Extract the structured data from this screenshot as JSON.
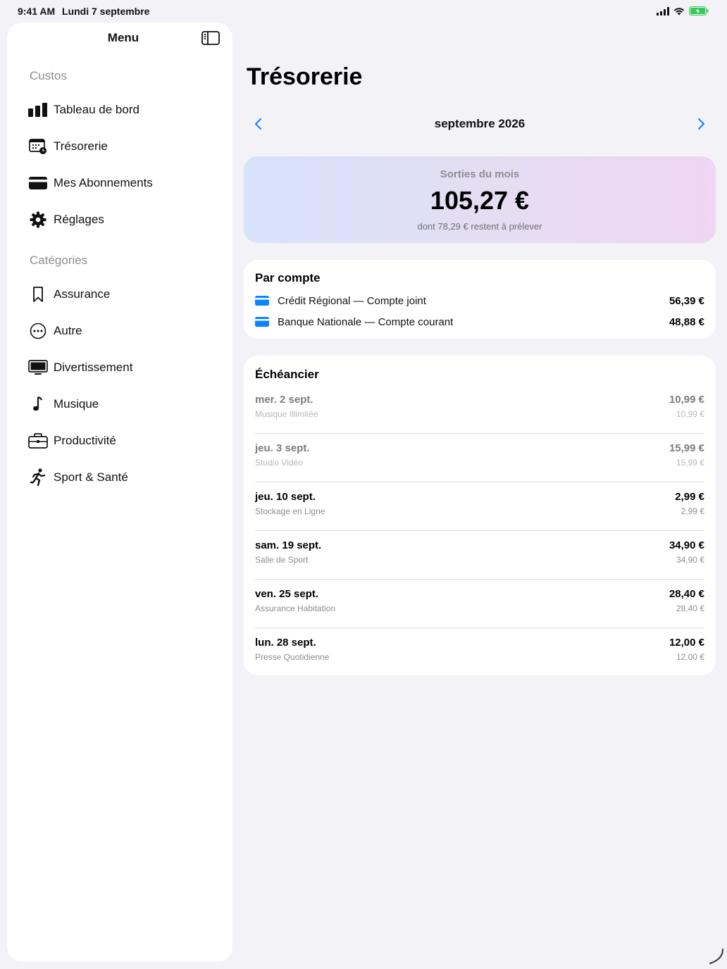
{
  "status": {
    "time": "9:41 AM",
    "date": "Lundi 7 septembre",
    "battery_color": "#34c759"
  },
  "sidebar": {
    "title": "Menu",
    "sections": [
      {
        "header": "Custos",
        "items": [
          {
            "label": "Tableau de bord",
            "icon": "chart-bar-icon"
          },
          {
            "label": "Trésorerie",
            "icon": "calendar-clock-icon"
          },
          {
            "label": "Mes Abonnements",
            "icon": "credit-card-icon"
          },
          {
            "label": "Réglages",
            "icon": "gear-icon"
          }
        ]
      },
      {
        "header": "Catégories",
        "items": [
          {
            "label": "Assurance",
            "icon": "bookmark-icon"
          },
          {
            "label": "Autre",
            "icon": "ellipsis-circle-icon"
          },
          {
            "label": "Divertissement",
            "icon": "tv-icon"
          },
          {
            "label": "Musique",
            "icon": "music-note-icon"
          },
          {
            "label": "Productivité",
            "icon": "briefcase-icon"
          },
          {
            "label": "Sport & Santé",
            "icon": "running-figure-icon"
          }
        ]
      }
    ]
  },
  "main": {
    "title": "Trésorerie",
    "month": "septembre 2026",
    "accent_color": "#0a84ff",
    "summary": {
      "label": "Sorties du mois",
      "amount": "105,27 €",
      "sub": "dont 78,29 € restent à prélever"
    },
    "accounts": {
      "title": "Par compte",
      "rows": [
        {
          "name": "Crédit Régional — Compte joint",
          "amount": "56,39 €"
        },
        {
          "name": "Banque Nationale — Compte courant",
          "amount": "48,88 €"
        }
      ]
    },
    "schedule": {
      "title": "Échéancier",
      "rows": [
        {
          "date": "mer. 2 sept.",
          "name": "Musique Illimitée",
          "amount": "10,99 €",
          "sub": "10,99 €",
          "past": true
        },
        {
          "date": "jeu. 3 sept.",
          "name": "Studio Vidéo",
          "amount": "15,99 €",
          "sub": "15,99 €",
          "past": true
        },
        {
          "date": "jeu. 10 sept.",
          "name": "Stockage en Ligne",
          "amount": "2,99 €",
          "sub": "2,99 €",
          "past": false
        },
        {
          "date": "sam. 19 sept.",
          "name": "Salle de Sport",
          "amount": "34,90 €",
          "sub": "34,90 €",
          "past": false
        },
        {
          "date": "ven. 25 sept.",
          "name": "Assurance Habitation",
          "amount": "28,40 €",
          "sub": "28,40 €",
          "past": false
        },
        {
          "date": "lun. 28 sept.",
          "name": "Presse Quotidienne",
          "amount": "12,00 €",
          "sub": "12,00 €",
          "past": false
        }
      ]
    }
  }
}
